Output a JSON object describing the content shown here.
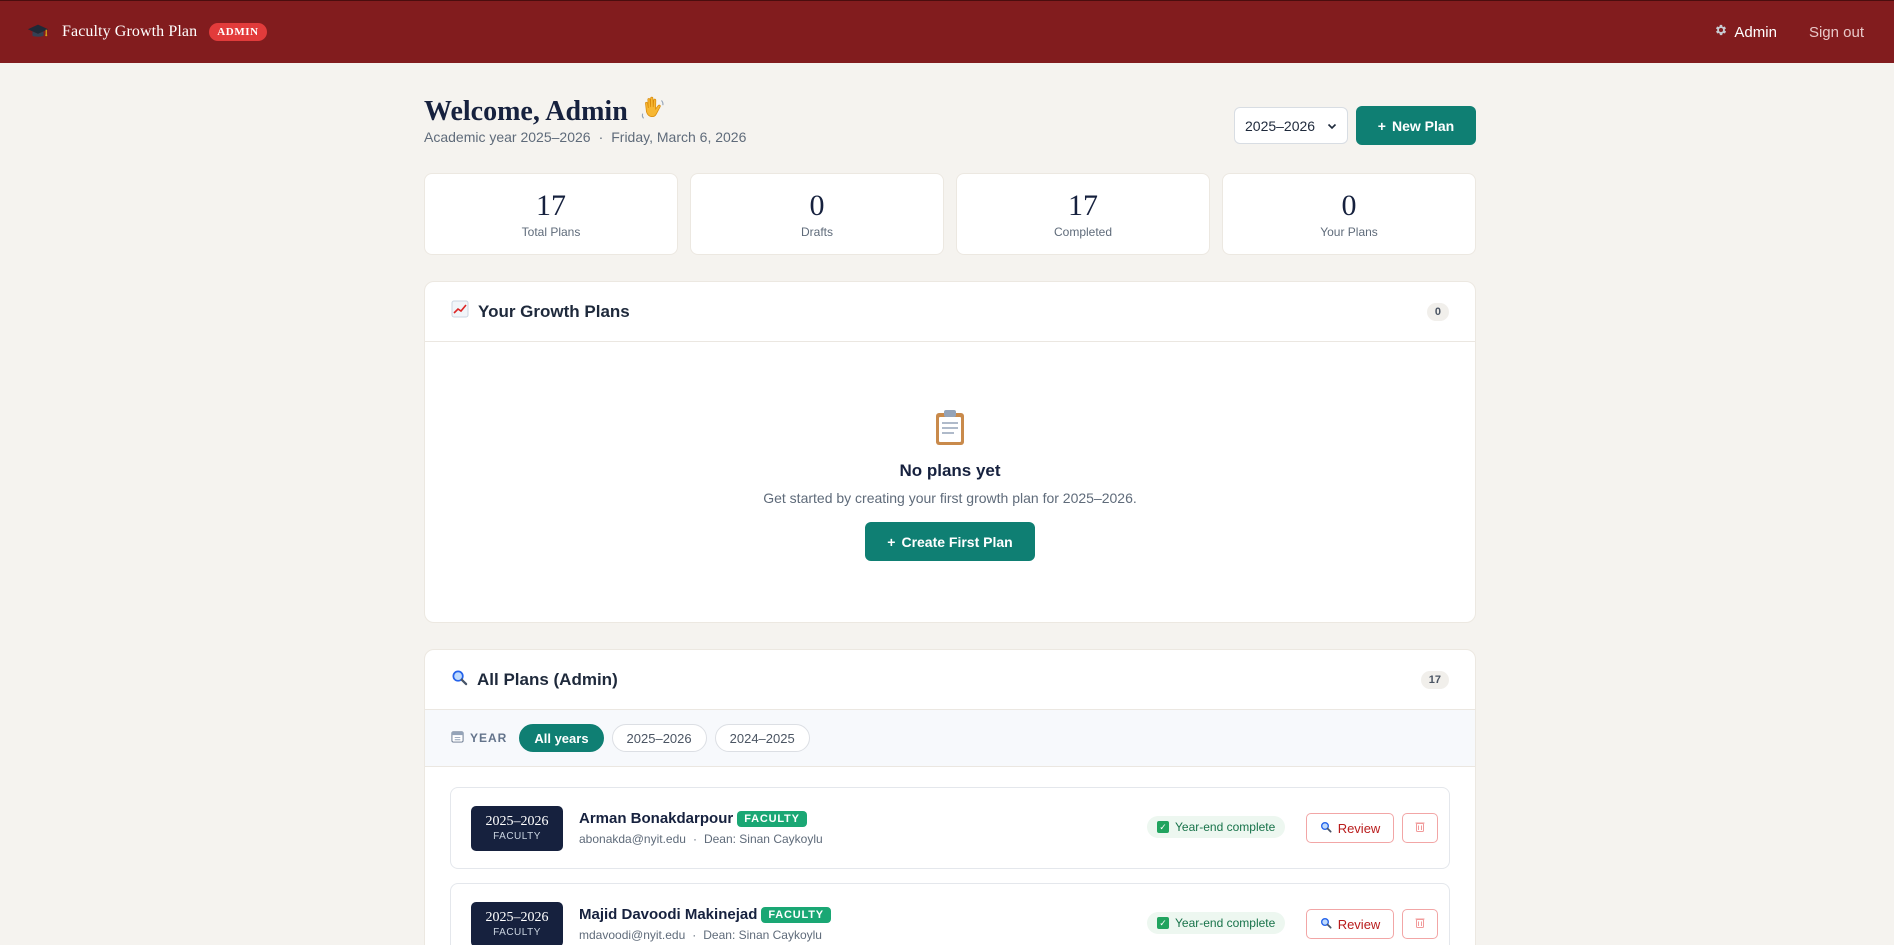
{
  "nav": {
    "brand_title": "Faculty Growth Plan",
    "admin_badge": "ADMIN",
    "admin_link": "Admin",
    "signout": "Sign out"
  },
  "header": {
    "welcome": "Welcome, Admin",
    "academic_year": "Academic year 2025–2026",
    "separator": "·",
    "date": "Friday, March 6, 2026",
    "year_select_value": "2025–2026",
    "new_plan_label": "New Plan",
    "plus": "+"
  },
  "stats": [
    {
      "value": "17",
      "label": "Total Plans"
    },
    {
      "value": "0",
      "label": "Drafts"
    },
    {
      "value": "17",
      "label": "Completed"
    },
    {
      "value": "0",
      "label": "Your Plans"
    }
  ],
  "your_plans": {
    "title": "Your Growth Plans",
    "count": "0",
    "empty_title": "No plans yet",
    "empty_sub": "Get started by creating your first growth plan for 2025–2026.",
    "create_label": "Create First Plan"
  },
  "all_plans": {
    "title": "All Plans (Admin)",
    "count": "17",
    "filter_label": "YEAR",
    "filters": [
      "All years",
      "2025–2026",
      "2024–2025"
    ],
    "rows": [
      {
        "year": "2025–2026",
        "role": "FACULTY",
        "name": "Arman Bonakdarpour",
        "tag": "FACULTY",
        "email": "abonakda@nyit.edu",
        "dean": "Dean: Sinan Caykoylu",
        "status": "Year-end complete",
        "review": "Review"
      },
      {
        "year": "2025–2026",
        "role": "FACULTY",
        "name": "Majid Davoodi Makinejad",
        "tag": "FACULTY",
        "email": "mdavoodi@nyit.edu",
        "dean": "Dean: Sinan Caykoylu",
        "status": "Year-end complete",
        "review": "Review"
      }
    ]
  },
  "colors": {
    "nav_bg": "#821c1e",
    "primary": "#0f7f73",
    "navy": "#16213e",
    "faculty_green": "#1aa774",
    "danger": "#b91c1c"
  },
  "icons": {
    "brand": "graduation-cap-icon",
    "admin": "gear-icon",
    "wave": "waving-hand-icon",
    "your_plans": "chart-increasing-icon",
    "empty": "clipboard-icon",
    "all_plans": "magnifier-icon",
    "year_filter": "calendar-icon",
    "status": "check-box-icon",
    "review": "magnifier-icon",
    "delete": "trash-icon"
  }
}
